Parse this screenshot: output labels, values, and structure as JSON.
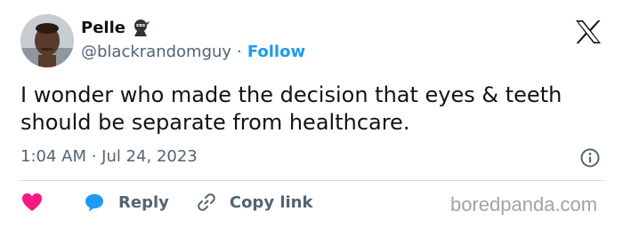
{
  "author": {
    "name": "Pelle",
    "handle": "@blackrandomguy",
    "separator": "·",
    "follow_label": "Follow",
    "avatar_icon": "profile-photo",
    "name_emoji": "ninja-emoji"
  },
  "platform": {
    "logo_icon": "x-logo"
  },
  "tweet": {
    "text": "I wonder who made the decision that eyes & teeth should be separate from healthcare.",
    "timestamp": "1:04 AM · Jul 24, 2023"
  },
  "actions": {
    "like_icon": "heart-icon",
    "reply_label": "Reply",
    "reply_icon": "speech-bubble-icon",
    "copy_link_label": "Copy link",
    "copy_link_icon": "link-icon"
  },
  "watermark": "boredpanda.com",
  "colors": {
    "accent": "#1d9bf0",
    "like": "#f91880",
    "text_primary": "#0f1419",
    "text_secondary": "#536471",
    "divider": "#cfd9de"
  }
}
